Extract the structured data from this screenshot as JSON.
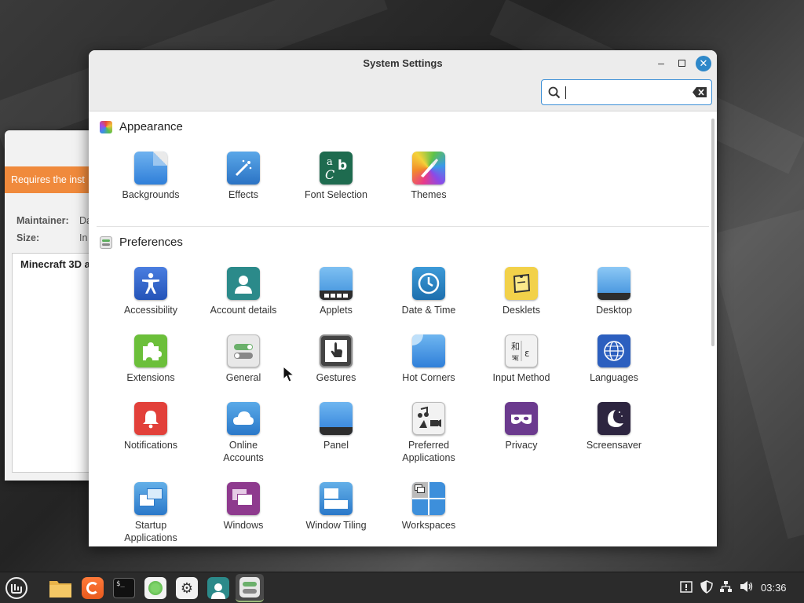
{
  "window": {
    "title": "System Settings",
    "search": {
      "value": "",
      "placeholder": ""
    }
  },
  "background_window": {
    "banner": "Requires the inst",
    "maintainer_label": "Maintainer:",
    "maintainer_value": "Da",
    "size_label": "Size:",
    "size_value": "In",
    "description": "Minecraft 3D a"
  },
  "sections": {
    "appearance": {
      "title": "Appearance",
      "items": [
        {
          "label": "Backgrounds",
          "icon": "backgrounds-icon"
        },
        {
          "label": "Effects",
          "icon": "effects-icon"
        },
        {
          "label": "Font Selection",
          "icon": "font-selection-icon"
        },
        {
          "label": "Themes",
          "icon": "themes-icon"
        }
      ]
    },
    "preferences": {
      "title": "Preferences",
      "items": [
        {
          "label": "Accessibility",
          "icon": "accessibility-icon"
        },
        {
          "label": "Account details",
          "icon": "account-icon"
        },
        {
          "label": "Applets",
          "icon": "applets-icon"
        },
        {
          "label": "Date & Time",
          "icon": "clock-icon"
        },
        {
          "label": "Desklets",
          "icon": "desklets-icon"
        },
        {
          "label": "Desktop",
          "icon": "desktop-icon"
        },
        {
          "label": "Extensions",
          "icon": "puzzle-icon"
        },
        {
          "label": "General",
          "icon": "toggles-icon"
        },
        {
          "label": "Gestures",
          "icon": "touch-icon"
        },
        {
          "label": "Hot Corners",
          "icon": "hot-corners-icon"
        },
        {
          "label": "Input Method",
          "icon": "input-method-icon"
        },
        {
          "label": "Languages",
          "icon": "globe-icon"
        },
        {
          "label": "Notifications",
          "icon": "bell-icon"
        },
        {
          "label": "Online Accounts",
          "icon": "cloud-icon"
        },
        {
          "label": "Panel",
          "icon": "panel-icon"
        },
        {
          "label": "Preferred Applications",
          "icon": "preferred-apps-icon"
        },
        {
          "label": "Privacy",
          "icon": "mask-icon"
        },
        {
          "label": "Screensaver",
          "icon": "moon-icon"
        },
        {
          "label": "Startup Applications",
          "icon": "startup-icon"
        },
        {
          "label": "Windows",
          "icon": "windows-icon"
        },
        {
          "label": "Window Tiling",
          "icon": "tiling-icon"
        },
        {
          "label": "Workspaces",
          "icon": "workspaces-icon"
        }
      ]
    }
  },
  "taskbar": {
    "clock": "03:36",
    "launchers": [
      "menu-icon",
      "folder-icon",
      "firefox-icon",
      "terminal-icon",
      "software-manager-icon",
      "settings-icon",
      "users-icon",
      "system-settings-icon"
    ]
  },
  "colors": {
    "accent": "#2e88c9",
    "banner": "#f08a3c"
  }
}
